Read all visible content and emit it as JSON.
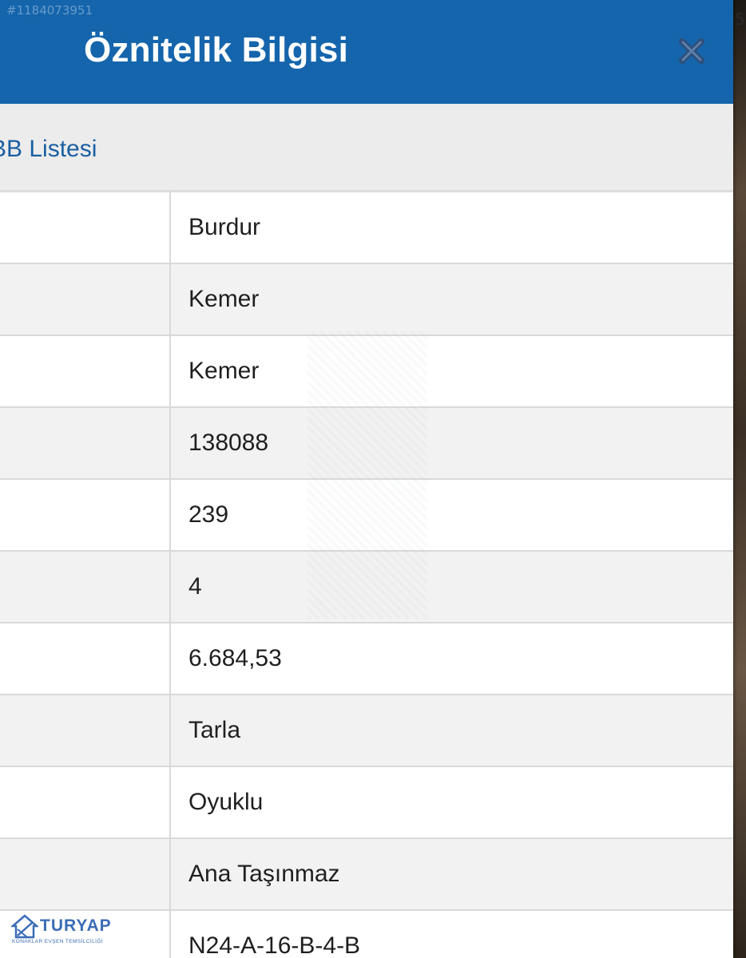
{
  "listing_id": "#1184073951",
  "edge_text": "5",
  "header": {
    "title": "Öznitelik Bilgisi",
    "close_icon": "close-icon"
  },
  "subbar": {
    "link_label": "BB Listesi"
  },
  "rows": [
    {
      "value": "Burdur"
    },
    {
      "value": "Kemer"
    },
    {
      "value": "Kemer"
    },
    {
      "value": "138088"
    },
    {
      "value": "239"
    },
    {
      "value": "4"
    },
    {
      "value": "6.684,53"
    },
    {
      "value": "Tarla"
    },
    {
      "value": "Oyuklu"
    },
    {
      "value": "Ana Taşınmaz"
    },
    {
      "value": "N24-A-16-B-4-B"
    }
  ],
  "logo": {
    "name": "TURYAP",
    "subtitle": "KONAKLAR EVŞEN TEMSİLCİLİĞİ"
  },
  "colors": {
    "header": "#1565ad",
    "link": "#1a5fa2",
    "close_icon": "#2f4f7a"
  }
}
